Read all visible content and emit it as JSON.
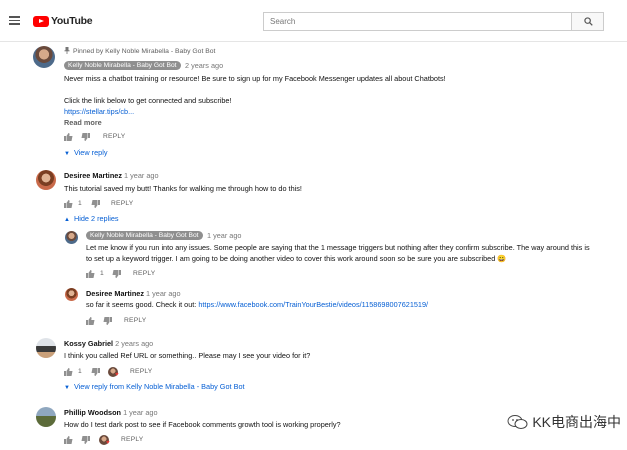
{
  "header": {
    "logo_text": "YouTube",
    "search_placeholder": "Search"
  },
  "comments": [
    {
      "pinned_text": "Pinned by Kelly Noble Mirabella - Baby Got Bot",
      "author": "Kelly Noble Mirabella - Baby Got Bot",
      "time": "2 years ago",
      "line1": "Never miss a chatbot training or resource! Be sure to sign up for my Facebook Messenger updates all about Chatbots!",
      "line2": "Click the link below to get connected and subscribe!",
      "link": "https://stellar.tips/cb...",
      "read_more": "Read more",
      "reply_label": "REPLY",
      "view_replies": "View reply"
    },
    {
      "author": "Desiree Martinez",
      "time": "1 year ago",
      "text": "This tutorial saved my butt! Thanks for walking me through how to do this!",
      "likes": "1",
      "reply_label": "REPLY",
      "hide_replies": "Hide 2 replies",
      "replies": [
        {
          "author": "Kelly Noble Mirabella - Baby Got Bot",
          "time": "1 year ago",
          "line1": "Let me know if you run into any issues. Some people are saying that the 1 message triggers but nothing after they confirm subscribe. The way around this is",
          "line2": "to set up a keyword trigger. I am going to be doing another video to cover this work around soon so be sure you are subscribed 😀",
          "likes": "1",
          "reply_label": "REPLY"
        },
        {
          "author": "Desiree Martinez",
          "time": "1 year ago",
          "text_prefix": "so far it seems good. Check it out: ",
          "link": "https://www.facebook.com/TrainYourBestie/videos/1158698007621519/",
          "reply_label": "REPLY"
        }
      ]
    },
    {
      "author": "Kossy Gabriel",
      "time": "2 years ago",
      "text": "I think you called Ref URL or something.. Please may I see your video for it?",
      "likes": "1",
      "reply_label": "REPLY",
      "view_replies": "View reply from Kelly Noble Mirabella - Baby Got Bot"
    },
    {
      "author": "Phillip Woodson",
      "time": "1 year ago",
      "text": "How do I test dark post to see if Facebook comments growth tool is working properly?",
      "reply_label": "REPLY"
    }
  ],
  "watermark": "KK电商出海中"
}
